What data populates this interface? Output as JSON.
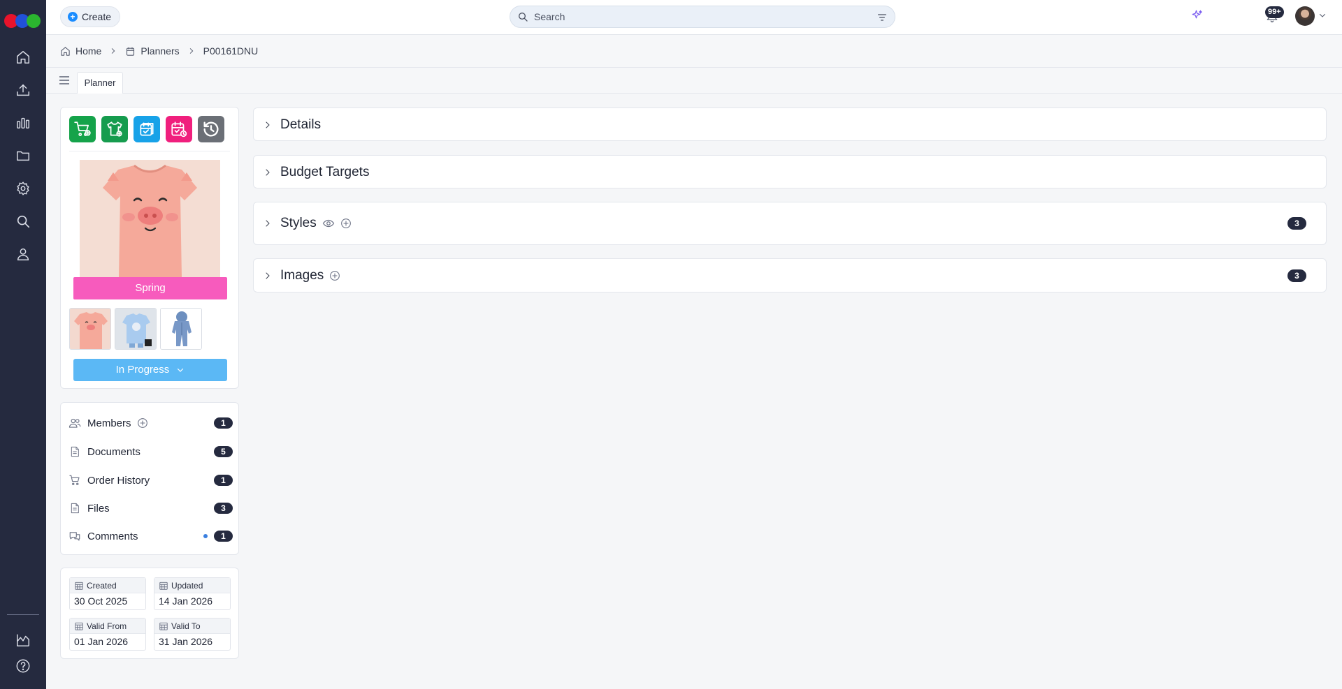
{
  "topbar": {
    "create_label": "Create",
    "search_placeholder": "Search",
    "notification_count": "99+"
  },
  "breadcrumb": [
    "Home",
    "Planners",
    "P00161DNU"
  ],
  "tabs": [
    "Planner"
  ],
  "item_panel": {
    "season_label": "Spring",
    "status_label": "In Progress",
    "action_colors": [
      "#15a34a",
      "#169c4e",
      "#17a2e8",
      "#f01f7d",
      "#6b6f76"
    ]
  },
  "related": [
    {
      "label": "Members",
      "count": "1"
    },
    {
      "label": "Documents",
      "count": "5"
    },
    {
      "label": "Order History",
      "count": "1"
    },
    {
      "label": "Files",
      "count": "3"
    },
    {
      "label": "Comments",
      "count": "1"
    }
  ],
  "dates": [
    {
      "label": "Created",
      "value": "30 Oct 2025"
    },
    {
      "label": "Updated",
      "value": "14 Jan 2026"
    },
    {
      "label": "Valid From",
      "value": "01 Jan 2026"
    },
    {
      "label": "Valid To",
      "value": "31 Jan 2026"
    }
  ],
  "sections": [
    {
      "title": "Details"
    },
    {
      "title": "Budget Targets"
    },
    {
      "title": "Styles",
      "count": "3"
    },
    {
      "title": "Images",
      "count": "3"
    }
  ]
}
